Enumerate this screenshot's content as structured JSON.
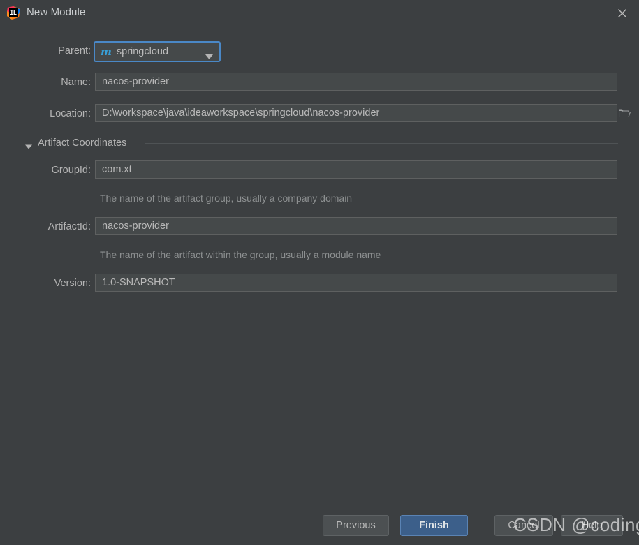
{
  "window": {
    "title": "New Module",
    "app_icon": "intellij-idea-icon",
    "close_icon": "close-icon",
    "background_color": "#3c3f41"
  },
  "form": {
    "parent": {
      "label": "Parent:",
      "value": "springcloud",
      "icon": "maven-module-icon",
      "icon_glyph": "m",
      "icon_color": "#389fd6",
      "focus_border_color": "#4a88c7",
      "dropdown_icon": "chevron-down-icon"
    },
    "name": {
      "label": "Name:",
      "value": "nacos-provider"
    },
    "location": {
      "label": "Location:",
      "value": "D:\\workspace\\java\\ideaworkspace\\springcloud\\nacos-provider",
      "browse_icon": "folder-icon"
    },
    "artifact_coordinates": {
      "title": "Artifact Coordinates",
      "expanded": true,
      "twisty_icon": "triangle-down-icon",
      "group_id": {
        "label": "GroupId:",
        "value": "com.xt",
        "hint": "The name of the artifact group, usually a company domain"
      },
      "artifact_id": {
        "label": "ArtifactId:",
        "value": "nacos-provider",
        "hint": "The name of the artifact within the group, usually a module name"
      },
      "version": {
        "label": "Version:",
        "value": "1.0-SNAPSHOT"
      }
    }
  },
  "buttons": {
    "previous": {
      "label": "Previous",
      "mnemonic": "P",
      "rest": "revious"
    },
    "finish": {
      "label": "Finish",
      "mnemonic": "F",
      "rest": "inish",
      "primary": true,
      "color": "#3c5f8a"
    },
    "cancel": {
      "label": "Cancel"
    },
    "help": {
      "label": "Help"
    }
  },
  "watermark": {
    "text": "CSDN @codingXT"
  }
}
